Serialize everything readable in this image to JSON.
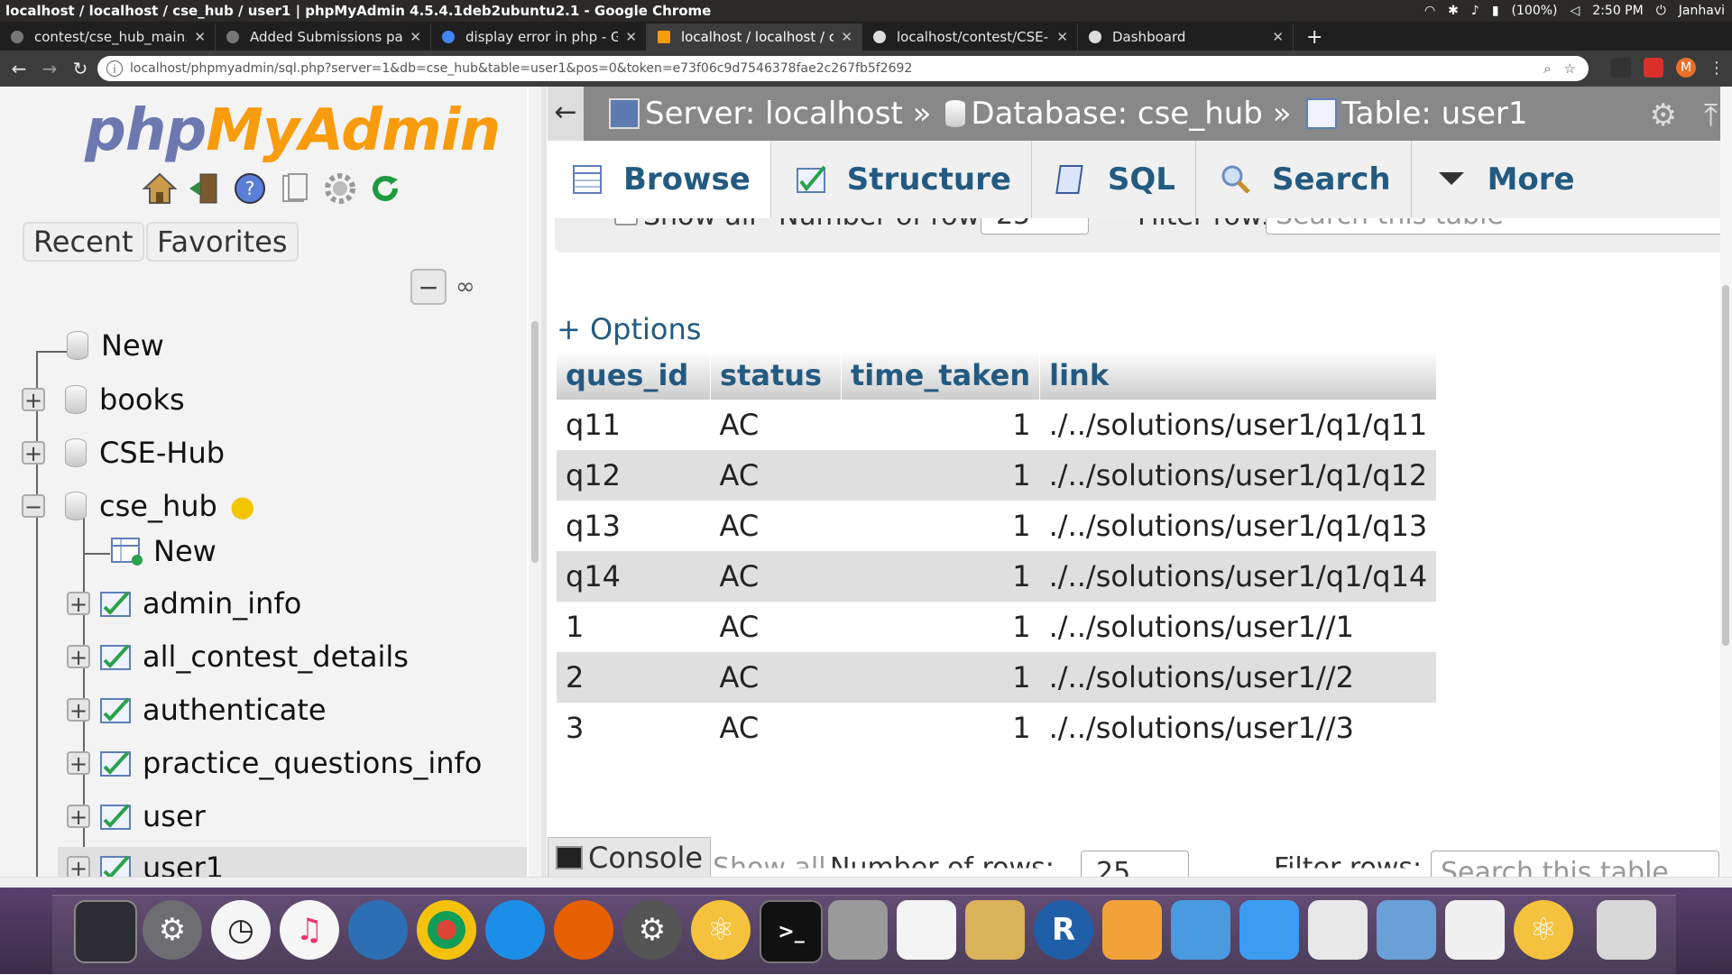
{
  "os": {
    "window_title": "localhost / localhost / cse_hub / user1 | phpMyAdmin 4.5.4.1deb2ubuntu2.1 - Google Chrome",
    "battery": "(100%)",
    "time": "2:50 PM",
    "user": "Janhavi"
  },
  "browser": {
    "tabs": [
      {
        "label": "contest/cse_hub_main.sq"
      },
      {
        "label": "Added Submissions page"
      },
      {
        "label": "display error in php - Goog"
      },
      {
        "label": "localhost / localhost / cse"
      },
      {
        "label": "localhost/contest/CSE-Hu"
      },
      {
        "label": "Dashboard"
      }
    ],
    "url": "localhost/phpmyadmin/sql.php?server=1&db=cse_hub&table=user1&pos=0&token=e73f06c9d7546378fae2c267fb5f2692",
    "profile_initial": "M"
  },
  "nav": {
    "logo_php": "php",
    "logo_myadmin": "MyAdmin",
    "recent": "Recent",
    "favorites": "Favorites",
    "tree": {
      "new_root": "New",
      "db_books": "books",
      "db_csehub": "CSE-Hub",
      "db_cse_hub": "cse_hub",
      "new_table": "New",
      "tables": [
        "admin_info",
        "all_contest_details",
        "authenticate",
        "practice_questions_info",
        "user",
        "user1"
      ]
    }
  },
  "header": {
    "server": "Server: localhost »",
    "database": "Database: cse_hub »",
    "table": "Table: user1"
  },
  "tabs": {
    "browse": "Browse",
    "structure": "Structure",
    "sql": "SQL",
    "search": "Search",
    "more": "More"
  },
  "pager": {
    "show_all": "Show all",
    "number_of_rows": "Number of rows:",
    "rows_value": "25",
    "filter_rows": "Filter rows:",
    "filter_placeholder": "Search this table"
  },
  "options": "+ Options",
  "table": {
    "columns": [
      "ques_id",
      "status",
      "time_taken",
      "link"
    ],
    "rows": [
      [
        "q11",
        "AC",
        "1",
        "./../solutions/user1/q1/q11"
      ],
      [
        "q12",
        "AC",
        "1",
        "./../solutions/user1/q1/q12"
      ],
      [
        "q13",
        "AC",
        "1",
        "./../solutions/user1/q1/q13"
      ],
      [
        "q14",
        "AC",
        "1",
        "./../solutions/user1/q1/q14"
      ],
      [
        "1",
        "AC",
        "1",
        "./../solutions/user1//1"
      ],
      [
        "2",
        "AC",
        "1",
        "./../solutions/user1//2"
      ],
      [
        "3",
        "AC",
        "1",
        "./../solutions/user1//3"
      ]
    ]
  },
  "console": "Console",
  "colors": {
    "link_blue": "#235a81",
    "header_gray": "#888888",
    "dock_purple": "#4a3559"
  }
}
